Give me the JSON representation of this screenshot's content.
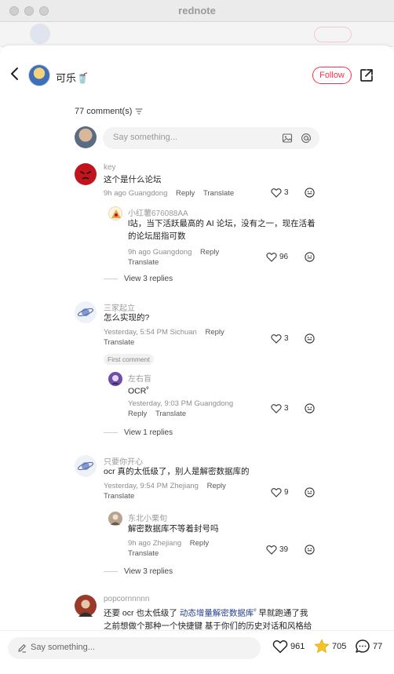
{
  "window": {
    "title": "rednote"
  },
  "header": {
    "author_name": "可乐🥤",
    "follow_label": "Follow"
  },
  "comments_count": "77 comment(s)",
  "input": {
    "placeholder": "Say something..."
  },
  "comments": [
    {
      "user": "key",
      "text": "这个是什么论坛",
      "time": "9h ago Guangdong",
      "reply": "Reply",
      "translate": "Translate",
      "likes": "3",
      "avatar_color": "#c0151f"
    },
    {
      "user": "小红薯676088AA",
      "text": "l站，当下活跃最高的 AI 论坛，没有之一，现在活着的论坛屈指可数",
      "time": "9h ago Guangdong",
      "reply": "Reply",
      "translate": "Translate",
      "likes": "96",
      "avatar_color": "#e9a23b"
    },
    {
      "view_replies": "View 3 replies"
    },
    {
      "user": "三家起立",
      "text": "怎么实现的?",
      "time": "Yesterday, 5:54 PM Sichuan",
      "reply": "Reply",
      "translate": "Translate",
      "likes": "3",
      "badge": "First comment",
      "avatar_color": "#dde4f2"
    },
    {
      "user": "左右盲",
      "text": "OCR",
      "time": "Yesterday, 9:03 PM Guangdong",
      "reply": "Reply",
      "translate": "Translate",
      "likes": "3",
      "avatar_color": "#6c4fa8"
    },
    {
      "view_replies": "View 1 replies"
    },
    {
      "user": "只要你开心",
      "text": "ocr 真的太低级了，别人是解密数据库的",
      "time": "Yesterday, 9:54 PM Zhejiang",
      "reply": "Reply",
      "translate": "Translate",
      "likes": "9",
      "avatar_color": "#dde4f2"
    },
    {
      "user": "东北小栗旬",
      "text": "解密数据库不等着封号吗",
      "time": "9h ago Zhejiang",
      "reply": "Reply",
      "translate": "Translate",
      "likes": "39",
      "avatar_color": "#b8a38f"
    },
    {
      "view_replies": "View 3 replies"
    },
    {
      "user": "popcornnnnn",
      "text_a": "还要 ocr 也太低级了",
      "link": "动态增量解密数据库",
      "text_b": "早就跑通了我之前想做个那种一个快捷键 基于你们的历史对话和风格给你候选回答的 不知道有没有人感兴趣",
      "avatar_color": "#9a3a2a"
    }
  ],
  "bottom": {
    "placeholder": "Say something...",
    "likes": "961",
    "favorites": "705",
    "comments": "77"
  },
  "colors": {
    "accent": "#ff2e4d",
    "link": "#25408f",
    "star": "#f7c325"
  }
}
